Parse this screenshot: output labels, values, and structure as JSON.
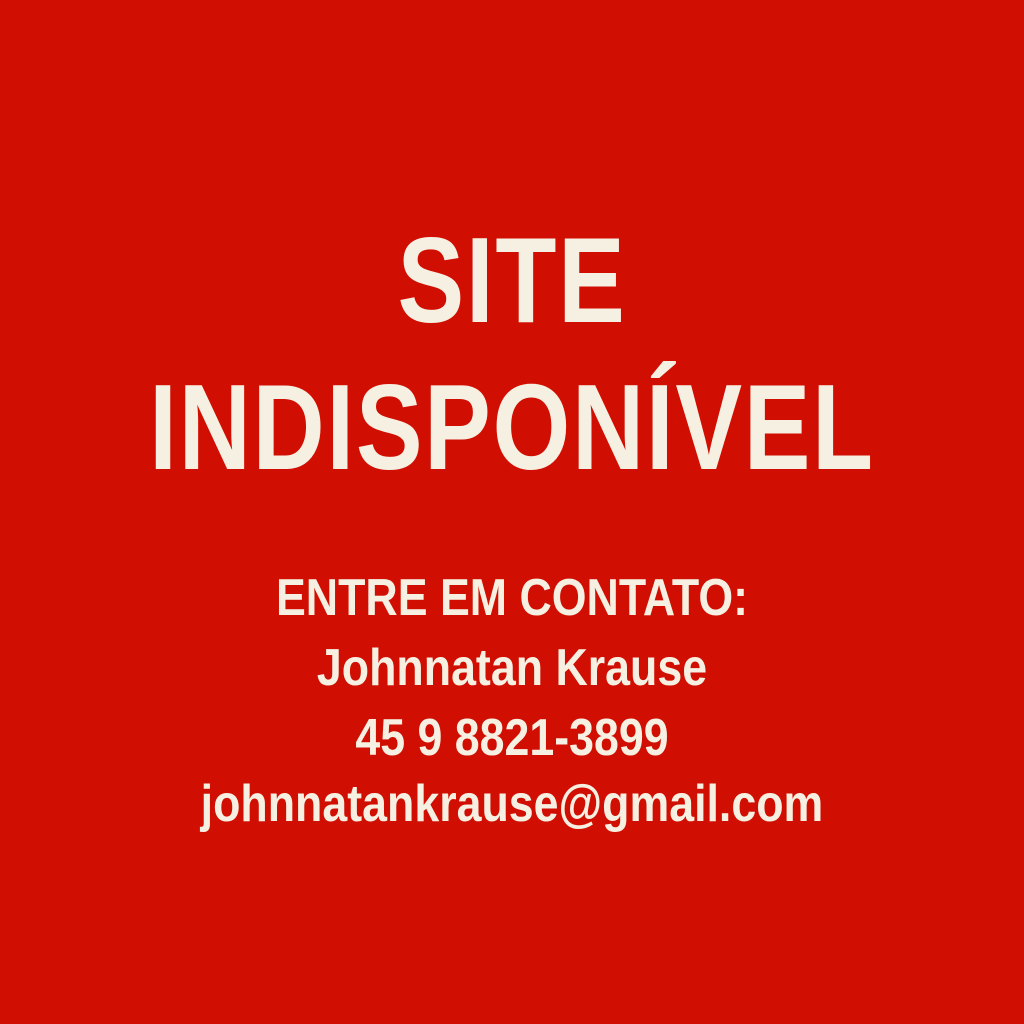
{
  "colors": {
    "background": "#d00e02",
    "text": "#f6f0e2"
  },
  "headline": {
    "line1": "SITE",
    "line2": "INDISPONÍVEL"
  },
  "contact": {
    "heading": "ENTRE EM CONTATO:",
    "name": "Johnnatan Krause",
    "phone": "45 9 8821-3899",
    "email": "johnnatankrause@gmail.com"
  }
}
